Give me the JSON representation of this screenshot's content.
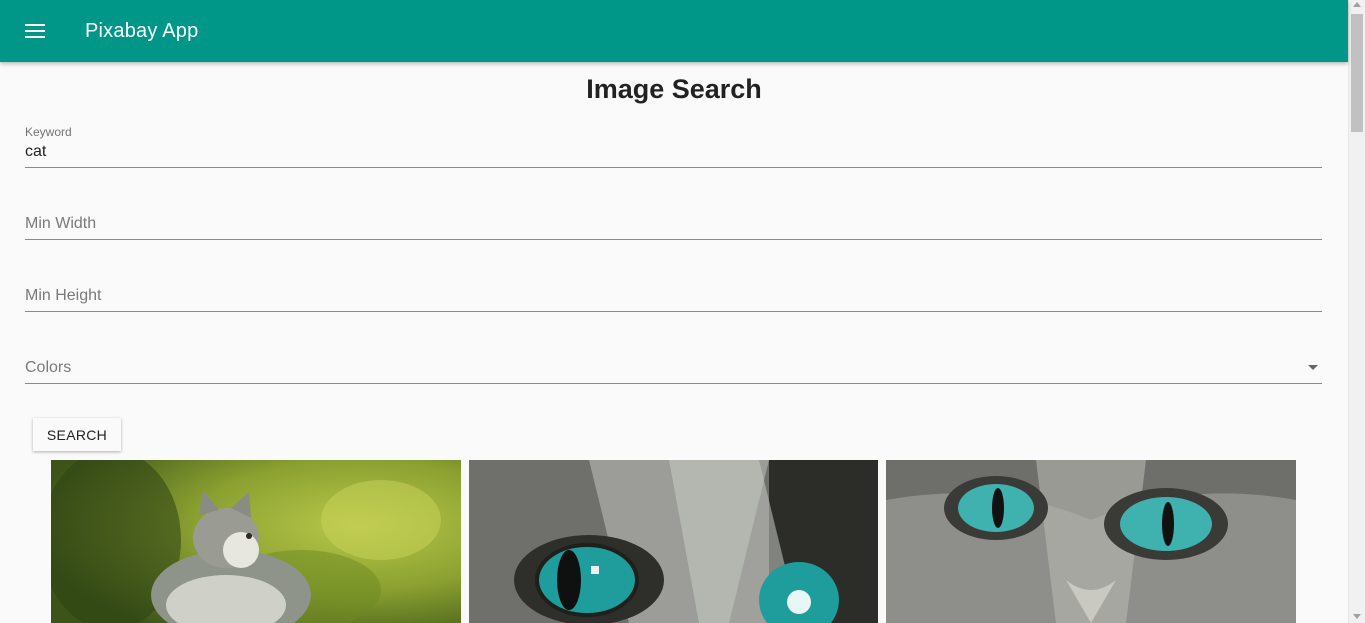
{
  "app": {
    "title": "Pixabay App",
    "menu_icon": "hamburger-menu-icon"
  },
  "page": {
    "heading": "Image Search"
  },
  "form": {
    "keyword": {
      "label": "Keyword",
      "value": "cat"
    },
    "min_width": {
      "placeholder": "Min Width",
      "value": ""
    },
    "min_height": {
      "placeholder": "Min Height",
      "value": ""
    },
    "colors": {
      "placeholder": "Colors",
      "value": ""
    },
    "search_label": "SEARCH"
  },
  "results": [
    {
      "subject": "kitten-in-grass"
    },
    {
      "subject": "cat-eye-closeup"
    },
    {
      "subject": "cat-face-closeup"
    }
  ],
  "colors": {
    "appbar": "#009688",
    "background": "#fafafa"
  }
}
